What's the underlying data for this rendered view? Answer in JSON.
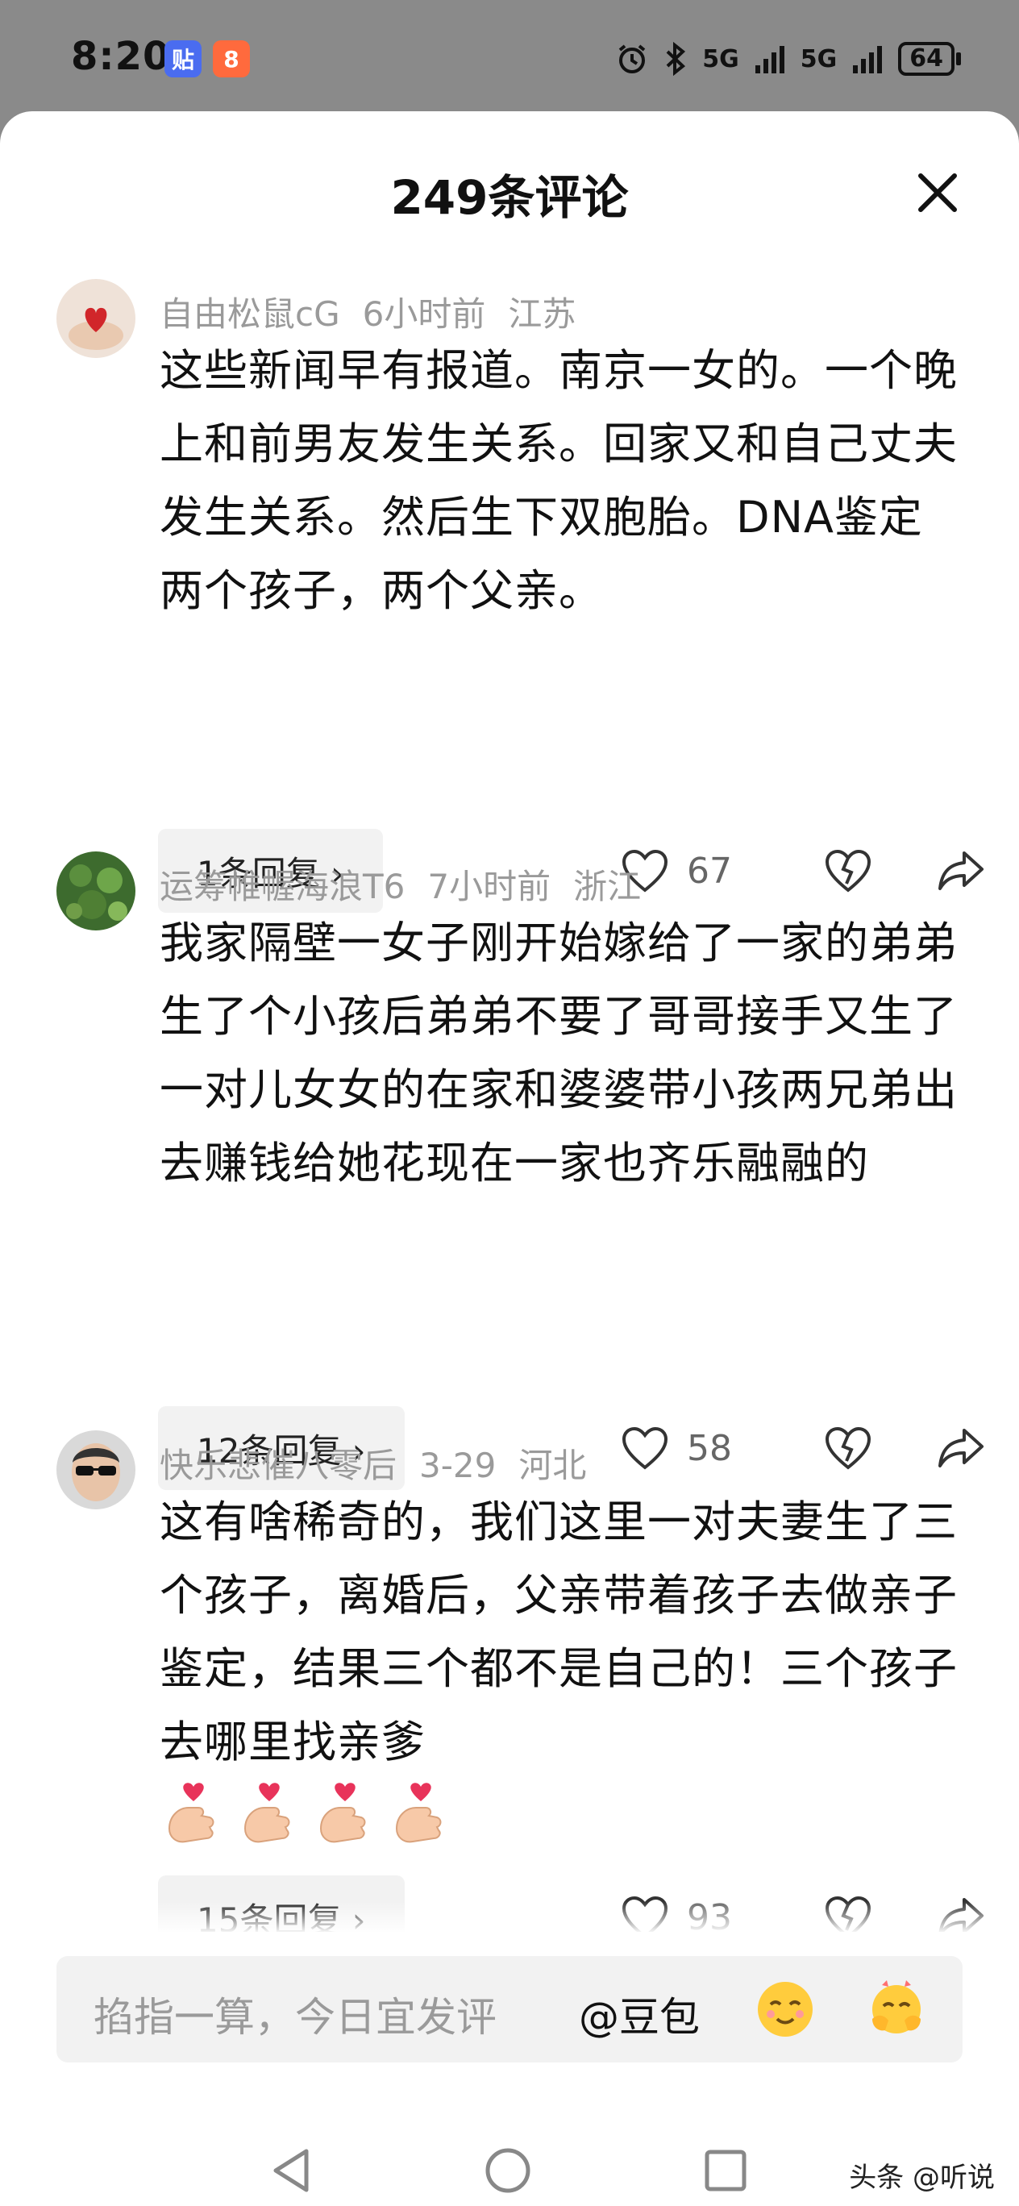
{
  "status_bar": {
    "time": "8:20",
    "app_badge_1": "贴",
    "app_badge_2": "8",
    "network_1": "5G",
    "network_2": "5G",
    "battery": "64"
  },
  "header": {
    "title": "249条评论"
  },
  "comments": [
    {
      "username": "自由松鼠cG",
      "time": "6小时前",
      "location": "江苏",
      "text": "这些新闻早有报道。南京一女的。一个晚上和前男友发生关系。回家又和自己丈夫发生关系。然后生下双胞胎。DNA鉴定两个孩子，两个父亲。",
      "reply_label": "1条回复 ›",
      "likes": "67"
    },
    {
      "username": "运筹帷幄海浪T6",
      "time": "7小时前",
      "location": "浙江",
      "text": "我家隔壁一女子刚开始嫁给了一家的弟弟生了个小孩后弟弟不要了哥哥接手又生了一对儿女女的在家和婆婆带小孩两兄弟出去赚钱给她花现在一家也齐乐融融的",
      "reply_label": "12条回复 ›",
      "likes": "58"
    },
    {
      "username": "快乐悲催八零后",
      "time": "3-29",
      "location": "河北",
      "text": "这有啥稀奇的，我们这里一对夫妻生了三个孩子，离婚后，父亲带着孩子去做亲子鉴定，结果三个都不是自己的！三个孩子去哪里找亲爹",
      "reply_label": "15条回复 ›",
      "likes": "93"
    }
  ],
  "input_bar": {
    "placeholder": "掐指一算，今日宜发评",
    "mention": "@豆包"
  },
  "watermark": "头条 @听说",
  "icons": {
    "close": "close-icon",
    "like": "heart-icon",
    "dislike": "broken-heart-icon",
    "share": "share-icon",
    "emoji": "emoji-icon",
    "finger_heart": "finger-heart-emoji"
  },
  "colors": {
    "meta_gray": "#9a9a9a",
    "reply_bg": "#f2f2f2",
    "status_bg": "#8a8a8a"
  }
}
